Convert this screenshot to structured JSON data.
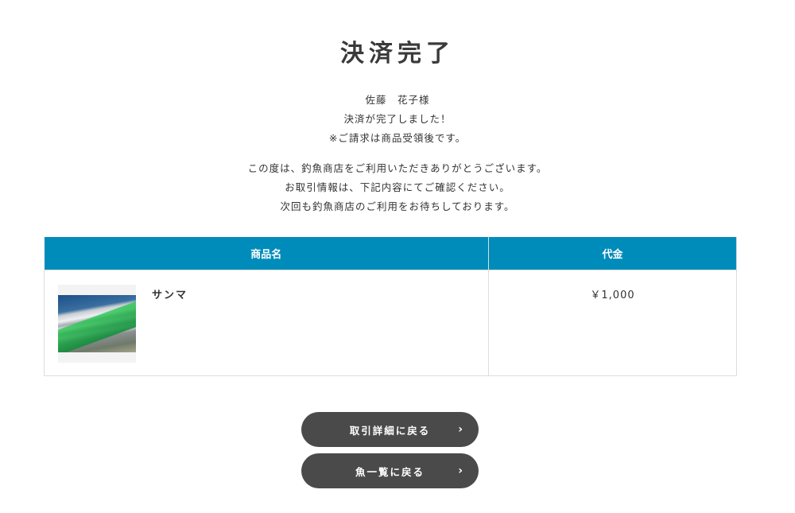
{
  "title": "決済完了",
  "messages": {
    "customer": "佐藤　花子様",
    "completed": "決済が完了しました！",
    "billing_note": "※ご請求は商品受領後です。",
    "thanks": "この度は、釣魚商店をご利用いただきありがとうございます。",
    "confirm": "お取引情報は、下記内容にてご確認ください。",
    "next_time": "次回も釣魚商店のご利用をお待ちしております。"
  },
  "table": {
    "headers": {
      "name": "商品名",
      "price": "代金"
    },
    "rows": [
      {
        "name": "サンマ",
        "price": "￥1,000",
        "image": "saury-photo"
      }
    ]
  },
  "buttons": {
    "transaction_detail": "取引詳細に戻る",
    "fish_list": "魚一覧に戻る",
    "chevron": "›"
  },
  "colors": {
    "header": "#008cba",
    "button": "#4a4a4a"
  }
}
